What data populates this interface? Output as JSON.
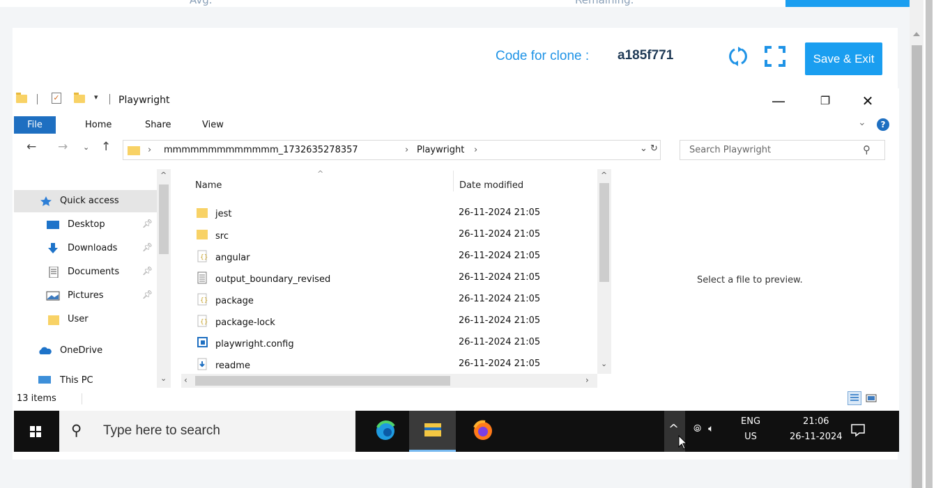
{
  "top_partial": {
    "left_text": "Avg.",
    "right_text": "Remaining."
  },
  "header": {
    "clone_label": "Code for clone : ",
    "clone_code": "a185f771",
    "save_exit_label": "Save & Exit",
    "accent_color": "#1a9ef0"
  },
  "explorer": {
    "title": "Playwright",
    "ribbon_tabs": [
      "File",
      "Home",
      "Share",
      "View"
    ],
    "address_crumbs": [
      "mmmmmmmmmmmmm_1732635278357",
      "Playwright"
    ],
    "search_placeholder": "Search Playwright",
    "nav_items": [
      {
        "label": "Quick access",
        "icon": "star-icon"
      },
      {
        "label": "Desktop",
        "icon": "desktop-icon"
      },
      {
        "label": "Downloads",
        "icon": "download-icon"
      },
      {
        "label": "Documents",
        "icon": "documents-icon"
      },
      {
        "label": "Pictures",
        "icon": "pictures-icon"
      },
      {
        "label": "User",
        "icon": "folder-icon"
      },
      {
        "label": "OneDrive",
        "icon": "cloud-icon"
      },
      {
        "label": "This PC",
        "icon": "computer-icon"
      }
    ],
    "columns": {
      "name": "Name",
      "date": "Date modified"
    },
    "files": [
      {
        "name": "jest",
        "date": "26-11-2024 21:05",
        "icon": "folder-icon"
      },
      {
        "name": "src",
        "date": "26-11-2024 21:05",
        "icon": "folder-icon"
      },
      {
        "name": "angular",
        "date": "26-11-2024 21:05",
        "icon": "json-file-icon"
      },
      {
        "name": "output_boundary_revised",
        "date": "26-11-2024 21:05",
        "icon": "text-file-icon"
      },
      {
        "name": "package",
        "date": "26-11-2024 21:05",
        "icon": "json-file-icon"
      },
      {
        "name": "package-lock",
        "date": "26-11-2024 21:05",
        "icon": "json-file-icon"
      },
      {
        "name": "playwright.config",
        "date": "26-11-2024 21:05",
        "icon": "ts-file-icon"
      },
      {
        "name": "readme",
        "date": "26-11-2024 21:05",
        "icon": "md-file-icon"
      }
    ],
    "preview_text": "Select a file to preview.",
    "status_count": "13 items"
  },
  "taskbar": {
    "search_placeholder": "Type here to search",
    "lang_top": "ENG",
    "lang_bottom": "US",
    "time": "21:06",
    "date": "26-11-2024"
  }
}
